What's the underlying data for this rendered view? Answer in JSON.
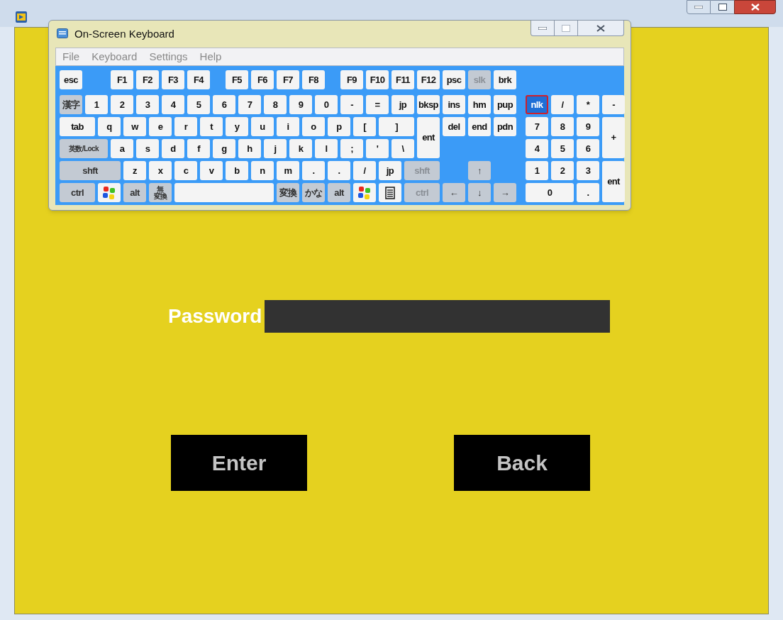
{
  "keyboard_window": {
    "title": "On-Screen Keyboard",
    "menu": [
      "File",
      "Keyboard",
      "Settings",
      "Help"
    ],
    "sections": [
      {
        "lines": [
          {
            "keys": [
              {
                "label": "esc",
                "kind": "plain"
              },
              {
                "label": "F1",
                "kind": "plain"
              },
              {
                "label": "F2",
                "kind": "plain"
              },
              {
                "label": "F3",
                "kind": "plain"
              },
              {
                "label": "F4",
                "kind": "plain"
              },
              {
                "label": "F5",
                "kind": "plain"
              },
              {
                "label": "F6",
                "kind": "plain"
              },
              {
                "label": "F7",
                "kind": "plain"
              },
              {
                "label": "F8",
                "kind": "plain"
              },
              {
                "label": "F9",
                "kind": "plain"
              },
              {
                "label": "F10",
                "kind": "plain"
              },
              {
                "label": "F11",
                "kind": "plain"
              },
              {
                "label": "F12",
                "kind": "plain"
              }
            ]
          },
          {
            "keys": [
              {
                "label": "漢字",
                "kind": "modifier"
              },
              {
                "label": "1",
                "kind": "plain"
              },
              {
                "label": "2",
                "kind": "plain"
              },
              {
                "label": "3",
                "kind": "plain"
              },
              {
                "label": "4",
                "kind": "plain"
              },
              {
                "label": "5",
                "kind": "plain"
              },
              {
                "label": "6",
                "kind": "plain"
              },
              {
                "label": "7",
                "kind": "plain"
              },
              {
                "label": "8",
                "kind": "plain"
              },
              {
                "label": "9",
                "kind": "plain"
              },
              {
                "label": "0",
                "kind": "plain"
              },
              {
                "label": "-",
                "kind": "plain"
              },
              {
                "label": "=",
                "kind": "plain"
              },
              {
                "label": "jp",
                "kind": "plain"
              },
              {
                "label": "bksp",
                "kind": "plain"
              }
            ]
          },
          {
            "keys": [
              {
                "label": "tab",
                "kind": "plain"
              },
              {
                "label": "q",
                "kind": "plain"
              },
              {
                "label": "w",
                "kind": "plain"
              },
              {
                "label": "e",
                "kind": "plain"
              },
              {
                "label": "r",
                "kind": "plain"
              },
              {
                "label": "t",
                "kind": "plain"
              },
              {
                "label": "y",
                "kind": "plain"
              },
              {
                "label": "u",
                "kind": "plain"
              },
              {
                "label": "i",
                "kind": "plain"
              },
              {
                "label": "o",
                "kind": "plain"
              },
              {
                "label": "p",
                "kind": "plain"
              },
              {
                "label": "[",
                "kind": "plain"
              },
              {
                "label": "]",
                "kind": "plain"
              },
              {
                "label": "ent",
                "kind": "plain"
              }
            ]
          },
          {
            "keys": [
              {
                "label": "英数/Lock",
                "kind": "modifier"
              },
              {
                "label": "a",
                "kind": "plain"
              },
              {
                "label": "s",
                "kind": "plain"
              },
              {
                "label": "d",
                "kind": "plain"
              },
              {
                "label": "f",
                "kind": "plain"
              },
              {
                "label": "g",
                "kind": "plain"
              },
              {
                "label": "h",
                "kind": "plain"
              },
              {
                "label": "j",
                "kind": "plain"
              },
              {
                "label": "k",
                "kind": "plain"
              },
              {
                "label": "l",
                "kind": "plain"
              },
              {
                "label": ";",
                "kind": "plain"
              },
              {
                "label": "'",
                "kind": "plain"
              },
              {
                "label": "\\",
                "kind": "plain"
              }
            ]
          },
          {
            "keys": [
              {
                "label": "shft",
                "kind": "modifier"
              },
              {
                "label": "z",
                "kind": "plain"
              },
              {
                "label": "x",
                "kind": "plain"
              },
              {
                "label": "c",
                "kind": "plain"
              },
              {
                "label": "v",
                "kind": "plain"
              },
              {
                "label": "b",
                "kind": "plain"
              },
              {
                "label": "n",
                "kind": "plain"
              },
              {
                "label": "m",
                "kind": "plain"
              },
              {
                "label": ".",
                "kind": "plain"
              },
              {
                "label": ".",
                "kind": "plain"
              },
              {
                "label": "/",
                "kind": "plain"
              },
              {
                "label": "jp",
                "kind": "plain"
              },
              {
                "label": "shft",
                "kind": "inactive"
              }
            ]
          },
          {
            "keys": [
              {
                "label": "ctrl",
                "kind": "modifier"
              },
              {
                "kind": "windows"
              },
              {
                "label": "alt",
                "kind": "modifier"
              },
              {
                "label": "無",
                "sublabel": "変換",
                "kind": "modifier"
              },
              {
                "kind": "space"
              },
              {
                "label": "変換",
                "kind": "modifier"
              },
              {
                "label": "かな",
                "kind": "modifier"
              },
              {
                "label": "alt",
                "kind": "modifier"
              },
              {
                "kind": "windows"
              },
              {
                "kind": "menu"
              },
              {
                "label": "ctrl",
                "kind": "inactive"
              }
            ]
          }
        ]
      },
      {
        "lines": [
          {
            "keys": [
              {
                "label": "psc",
                "kind": "plain"
              },
              {
                "label": "slk",
                "kind": "inactive"
              },
              {
                "label": "brk",
                "kind": "plain"
              }
            ]
          },
          {
            "keys": [
              {
                "label": "ins",
                "kind": "plain"
              },
              {
                "label": "hm",
                "kind": "plain"
              },
              {
                "label": "pup",
                "kind": "plain"
              }
            ]
          },
          {
            "keys": [
              {
                "label": "del",
                "kind": "plain"
              },
              {
                "label": "end",
                "kind": "plain"
              },
              {
                "label": "pdn",
                "kind": "plain"
              }
            ]
          },
          {
            "keys": [
              {
                "label": "↑",
                "kind": "modifier"
              }
            ]
          },
          {
            "keys": [
              {
                "label": "←",
                "kind": "modifier"
              },
              {
                "label": "↓",
                "kind": "modifier"
              },
              {
                "label": "→",
                "kind": "modifier"
              }
            ]
          }
        ]
      },
      {
        "lines": [
          {
            "keys": [
              {
                "label": "nlk",
                "kind": "active"
              },
              {
                "label": "/",
                "kind": "plain"
              },
              {
                "label": "*",
                "kind": "plain"
              },
              {
                "label": "-",
                "kind": "plain"
              }
            ]
          },
          {
            "keys": [
              {
                "label": "7",
                "kind": "plain"
              },
              {
                "label": "8",
                "kind": "plain"
              },
              {
                "label": "9",
                "kind": "plain"
              },
              {
                "label": "+",
                "kind": "plain"
              }
            ]
          },
          {
            "keys": [
              {
                "label": "4",
                "kind": "plain"
              },
              {
                "label": "5",
                "kind": "plain"
              },
              {
                "label": "6",
                "kind": "plain"
              }
            ]
          },
          {
            "keys": [
              {
                "label": "1",
                "kind": "plain"
              },
              {
                "label": "2",
                "kind": "plain"
              },
              {
                "label": "3",
                "kind": "plain"
              },
              {
                "label": "ent",
                "kind": "plain"
              }
            ]
          },
          {
            "keys": [
              {
                "label": "0",
                "kind": "plain"
              },
              {
                "label": ".",
                "kind": "plain"
              }
            ]
          }
        ]
      }
    ]
  },
  "form": {
    "label": "Password"
  },
  "buttons": [
    "Enter",
    "Back"
  ]
}
